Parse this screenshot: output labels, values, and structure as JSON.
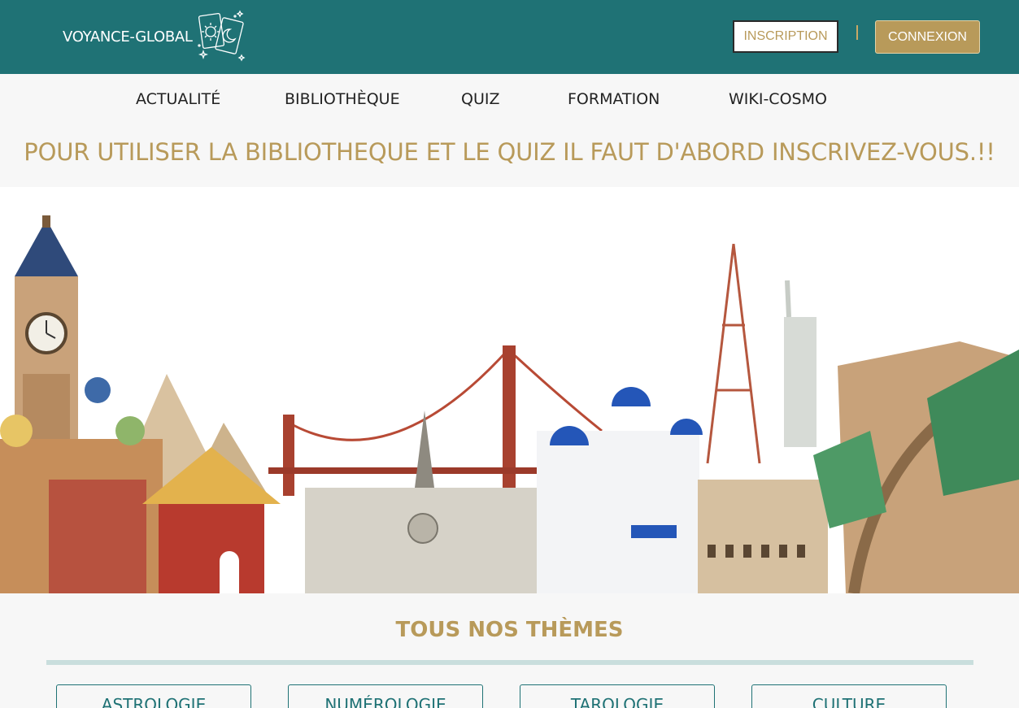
{
  "header": {
    "brand": "VOYANCE-GLOBAL",
    "logo_icon": "tarot-cards-icon",
    "inscription_label": "INSCRIPTION",
    "connexion_label": "CONNEXION",
    "colors": {
      "bar": "#1f7275",
      "gold": "#b89a5a"
    }
  },
  "nav": {
    "items": [
      {
        "label": "ACTUALITÉ"
      },
      {
        "label": "BIBLIOTHÈQUE"
      },
      {
        "label": "QUIZ"
      },
      {
        "label": "FORMATION"
      },
      {
        "label": "WIKI-COSMO"
      }
    ]
  },
  "notice": "POUR UTILISER LA BIBLIOTHEQUE ET LE QUIZ IL FAUT D'ABORD INSCRIVEZ-VOUS.!!",
  "hero": {
    "image": "world-landmarks-watercolor-illustration"
  },
  "themes": {
    "title": "TOUS NOS THÈMES",
    "items": [
      {
        "label": "ASTROLOGIE"
      },
      {
        "label": "NUMÉROLOGIE"
      },
      {
        "label": "TAROLOGIE"
      },
      {
        "label": "CULTURE"
      }
    ]
  }
}
